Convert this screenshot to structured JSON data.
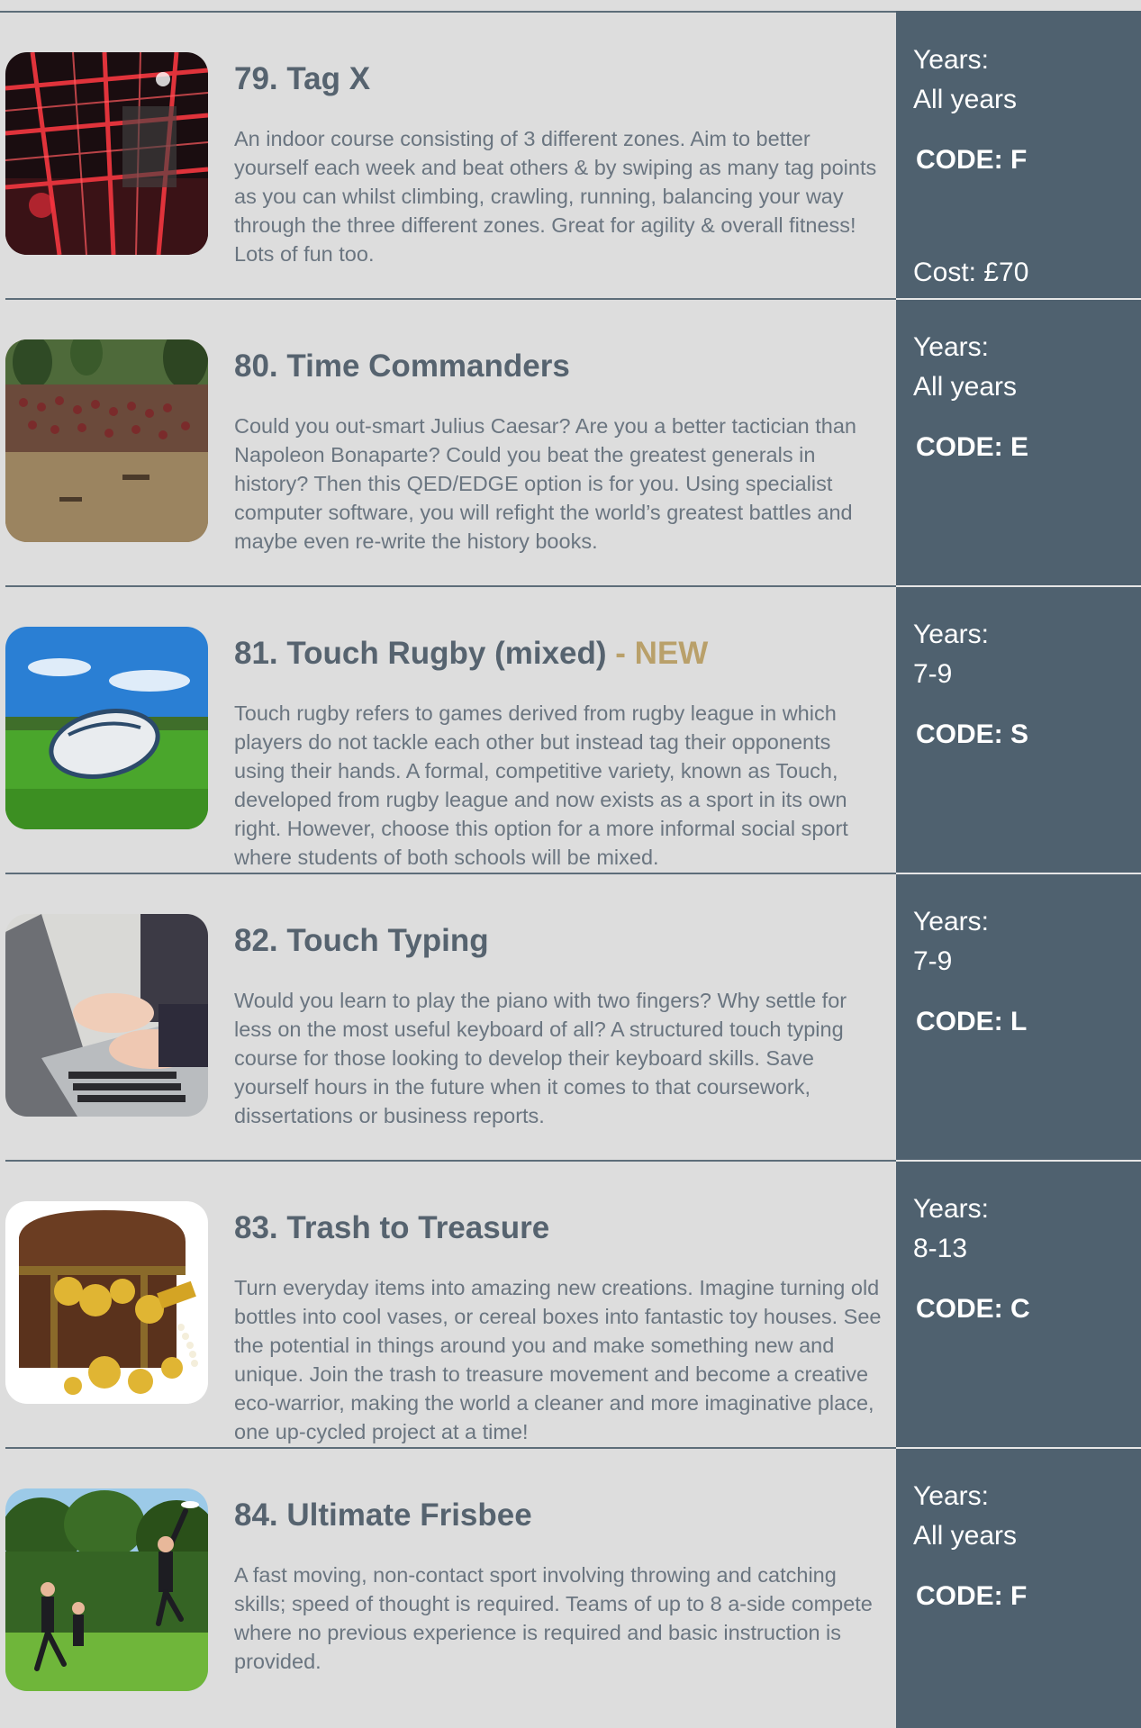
{
  "activities": [
    {
      "title": "79. Tag X",
      "badge": "",
      "description": "An indoor course consisting of 3 different zones. Aim to better yourself each week and beat others & by swiping as many tag points as you can whilst climbing, crawling, running, balancing your way through the three different zones. Great for agility & overall fitness! Lots of fun too.",
      "years_label": "Years:",
      "years": "All years",
      "code": "CODE: F",
      "cost": "Cost: £70",
      "image": "indoor-course-photo"
    },
    {
      "title": "80. Time Commanders",
      "badge": "",
      "description": "Could you out-smart Julius Caesar? Are you a better tactician than Napoleon Bonaparte? Could you beat the greatest generals in history? Then this QED/EDGE option is for you. Using specialist computer software, you will refight the world’s greatest battles and maybe even re-write the history books.",
      "years_label": "Years:",
      "years": "All years",
      "code": "CODE: E",
      "cost": "",
      "image": "battle-scene-photo"
    },
    {
      "title": "81. Touch Rugby (mixed)",
      "badge": " - NEW",
      "description": "Touch rugby refers to games derived from rugby league in which players do not tackle each other but instead tag their opponents using their hands. A formal, competitive variety, known as Touch, developed from rugby league and now exists as a sport in its own right. However, choose this option for a more informal social sport where students of both schools will be mixed.",
      "years_label": "Years:",
      "years": "7-9",
      "code": "CODE: S",
      "cost": "",
      "image": "rugby-ball-photo"
    },
    {
      "title": "82. Touch Typing",
      "badge": "",
      "description": "Would you learn to play the piano with two fingers? Why settle for less on the most useful keyboard of all? A structured touch typing course for those looking to develop their keyboard skills. Save yourself hours in the future when it comes to that coursework, dissertations or business reports.",
      "years_label": "Years:",
      "years": "7-9",
      "code": "CODE: L",
      "cost": "",
      "image": "typing-laptop-photo"
    },
    {
      "title": "83. Trash to Treasure",
      "badge": "",
      "description": "Turn everyday items into amazing new creations. Imagine turning old bottles into cool vases, or cereal boxes into fantastic toy houses. See the potential in things around you and make something new and unique. Join the trash to treasure movement and become a creative eco-warrior, making the world a cleaner and more imaginative place, one up-cycled project at a time!",
      "years_label": "Years:",
      "years": "8-13",
      "code": "CODE: C",
      "cost": "",
      "image": "treasure-chest-photo"
    },
    {
      "title": "84. Ultimate Frisbee",
      "badge": "",
      "description": "A fast moving, non-contact sport involving throwing and catching skills; speed of thought is required. Teams of up to 8 a-side compete where no previous experience is required and basic instruction is provided.",
      "years_label": "Years:",
      "years": "All years",
      "code": "CODE: F",
      "cost": "",
      "image": "frisbee-players-photo"
    }
  ]
}
